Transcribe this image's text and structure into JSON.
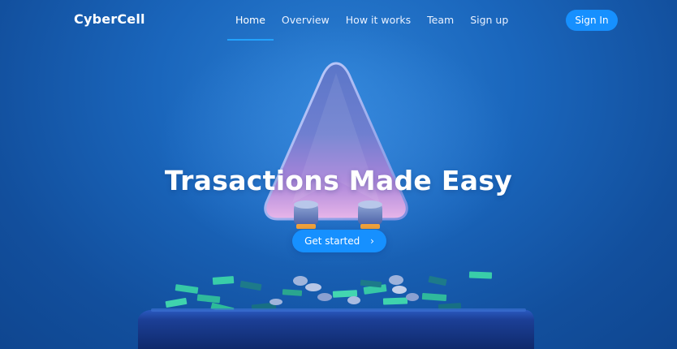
{
  "brand": {
    "name": "CyberCell"
  },
  "nav": {
    "items": [
      {
        "label": "Home",
        "active": true
      },
      {
        "label": "Overview",
        "active": false
      },
      {
        "label": "How it works",
        "active": false
      },
      {
        "label": "Team",
        "active": false
      },
      {
        "label": "Sign up",
        "active": false
      }
    ],
    "signin_label": "Sign In"
  },
  "hero": {
    "title": "Trasactions Made Easy",
    "cta_label": "Get started",
    "cta_icon": "chevron-right-icon"
  },
  "colors": {
    "background": "#1a66bc",
    "accent": "#1690ff",
    "active_underline": "#22a3ff",
    "text": "#ffffff"
  }
}
